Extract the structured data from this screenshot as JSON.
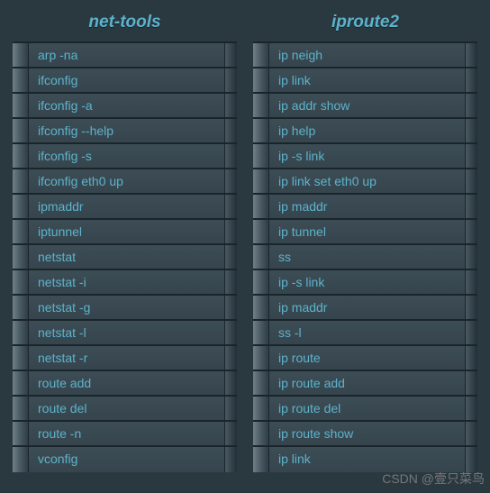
{
  "columns": [
    {
      "header": "net-tools",
      "items": [
        "arp -na",
        "ifconfig",
        "ifconfig -a",
        "ifconfig --help",
        "ifconfig -s",
        "ifconfig eth0 up",
        "ipmaddr",
        "iptunnel",
        "netstat",
        "netstat -i",
        "netstat  -g",
        "netstat -l",
        "netstat -r",
        "route add",
        "route del",
        "route -n",
        "vconfig"
      ]
    },
    {
      "header": "iproute2",
      "items": [
        "ip neigh",
        "ip link",
        "ip addr show",
        "ip help",
        "ip -s link",
        "ip link set eth0 up",
        "ip maddr",
        "ip tunnel",
        "ss",
        "ip -s link",
        "ip maddr",
        "ss -l",
        "ip route",
        "ip route add",
        "ip route del",
        "ip route show",
        "ip link"
      ]
    }
  ],
  "watermark": "CSDN @壹只菜鸟"
}
